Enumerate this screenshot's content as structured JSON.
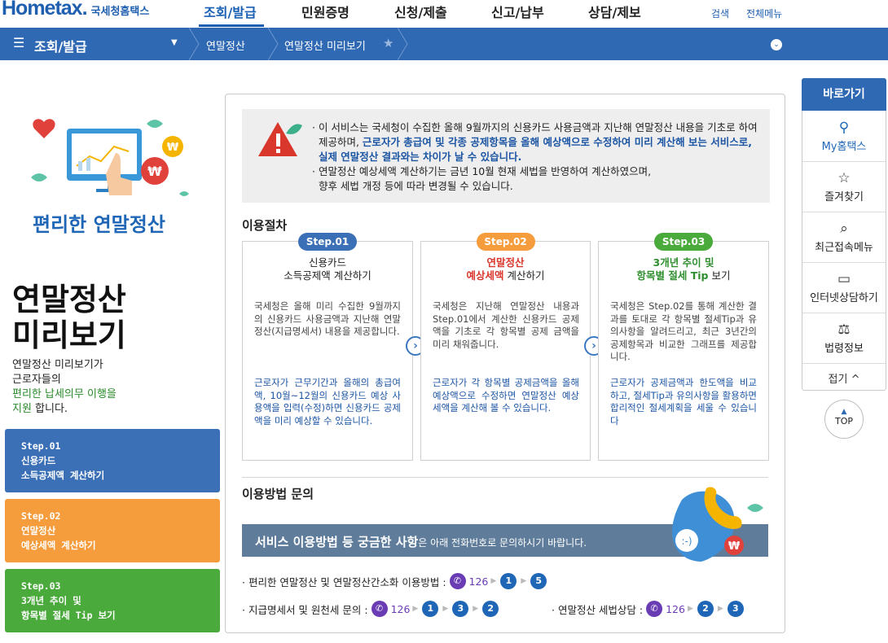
{
  "header": {
    "logo_text": "Hometax.",
    "logo_sub": "국세청홈택스",
    "nav": [
      "조회/발급",
      "민원증명",
      "신청/제출",
      "신고/납부",
      "상담/제보"
    ],
    "search_label": "검색",
    "all_menu_label": "전체메뉴"
  },
  "location": {
    "menu_title": "조회/발급",
    "crumbs": [
      "연말정산",
      "연말정산 미리보기"
    ]
  },
  "left": {
    "illustration_title": "편리한 연말정산",
    "big_title_line1": "연말정산",
    "big_title_line2": "미리보기",
    "desc_line1": "연말정산 미리보기가",
    "desc_line2": "근로자들의",
    "desc_line3": "편리한 납세의무 이행을",
    "desc_line4_green": "지원",
    "desc_line4_rest": " 합니다.",
    "steps": [
      {
        "line1": "Step.01",
        "line2": "신용카드",
        "line3": "소득공제액 계산하기",
        "color": "#3b6fb6"
      },
      {
        "line1": "Step.02",
        "line2": "연말정산",
        "line3": "예상세액 계산하기",
        "color": "#f59c3c"
      },
      {
        "line1": "Step.03",
        "line2": "3개년 추이 및",
        "line3": "항목별 절세 Tip 보기",
        "color": "#4aaa3b"
      }
    ]
  },
  "notice": {
    "p1_a": "· 이 서비스는 국세청이 수집한 올해 9월까지의 신용카드 사용금액과 지난해 연말정산 내용을 기초로 하여",
    "p1_b": "제공하며, ",
    "p1_c": "근로자가 총급여 및 각종 공제항목을 올해 예상액으로 수정하여 미리 계산해 보는 서비스로,",
    "p1_d": "실제 연말정산 결과와는 차이가 날 수 있습니다.",
    "p2_a": "· 연말정산 예상세액 계산하기는 금년 10월 현재 세법을 반영하여 계산하였으며,",
    "p2_b": "향후 세법 개정 등에 따라 변경될 수 있습니다."
  },
  "procedure": {
    "title": "이용절차",
    "steps": [
      {
        "pill": "Step.01",
        "pill_color": "#3b6fb6",
        "title1": "신용카드",
        "title2": "소득공제액 계산하기",
        "body": "국세청은 올해 미리 수집한 9월까지의 신용카드 사용금액과 지난해 연말정산(지급명세서) 내용을 제공합니다.",
        "body_blue": "근로자가 근무기간과 올해의 총급여액, 10월~12월의 신용카드 예상 사용액을 입력(수정)하면 신용카드 공제액을 미리 예상할 수 있습니다."
      },
      {
        "pill": "Step.02",
        "pill_color": "#f59c3c",
        "title1": "연말정산",
        "title2a": "예상세액",
        "title2b": " 계산하기",
        "body": "국세청은 지난해 연말정산 내용과 Step.01에서 계산한 신용카드 공제액을 기초로 각 항목별 공제 금액을 미리 채워줍니다.",
        "body_blue": "근로자가 각 항목별 공제금액을 올해예상액으로 수정하면 연말정산 예상세액을 계산해 볼 수 있습니다."
      },
      {
        "pill": "Step.03",
        "pill_color": "#4aaa3b",
        "title1": "3개년 추이 및",
        "title2a": "항목별 절세 Tip",
        "title2b": " 보기",
        "body": "국세청은 Step.02를 통해 계산한 결과를 토대로 각 항목별 절세Tip과 유의사항을 알려드리고, 최근 3년간의 공제항목과 비교한 그래프를 제공합니다.",
        "body_blue": "근로자가 공제금액과 한도액을 비교하고, 절세Tip과 유의사항을 활용하면 합리적인 절세계획을 세울 수 있습니다"
      }
    ]
  },
  "inquiry": {
    "title": "이용방법 문의",
    "banner_bold": "서비스 이용방법 등 궁금한 사항",
    "banner_rest": "은 아래 전화번호로 문의하시기 바랍니다.",
    "line1_label": "· 편리한 연말정산 및 연말정산간소화 이용방법 :",
    "line1_tel": "126",
    "line1_seq": [
      "1",
      "5"
    ],
    "line2_label": "· 지급명세서 및 원천세 문의 :",
    "line2_tel": "126",
    "line2_seq": [
      "1",
      "3",
      "2"
    ],
    "line3_label": "· 연말정산 세법상담 :",
    "line3_tel": "126",
    "line3_seq": [
      "2",
      "3"
    ]
  },
  "quick": {
    "title": "바로가기",
    "items": [
      {
        "label": "My홈택스",
        "icon": "person-icon"
      },
      {
        "label": "즐겨찾기",
        "icon": "star-icon"
      },
      {
        "label": "최근접속메뉴",
        "icon": "recent-icon"
      },
      {
        "label": "인터넷상담하기",
        "icon": "laptop-icon"
      },
      {
        "label": "법령정보",
        "icon": "gavel-icon"
      }
    ],
    "fold": "접기 ^",
    "top": "TOP"
  }
}
